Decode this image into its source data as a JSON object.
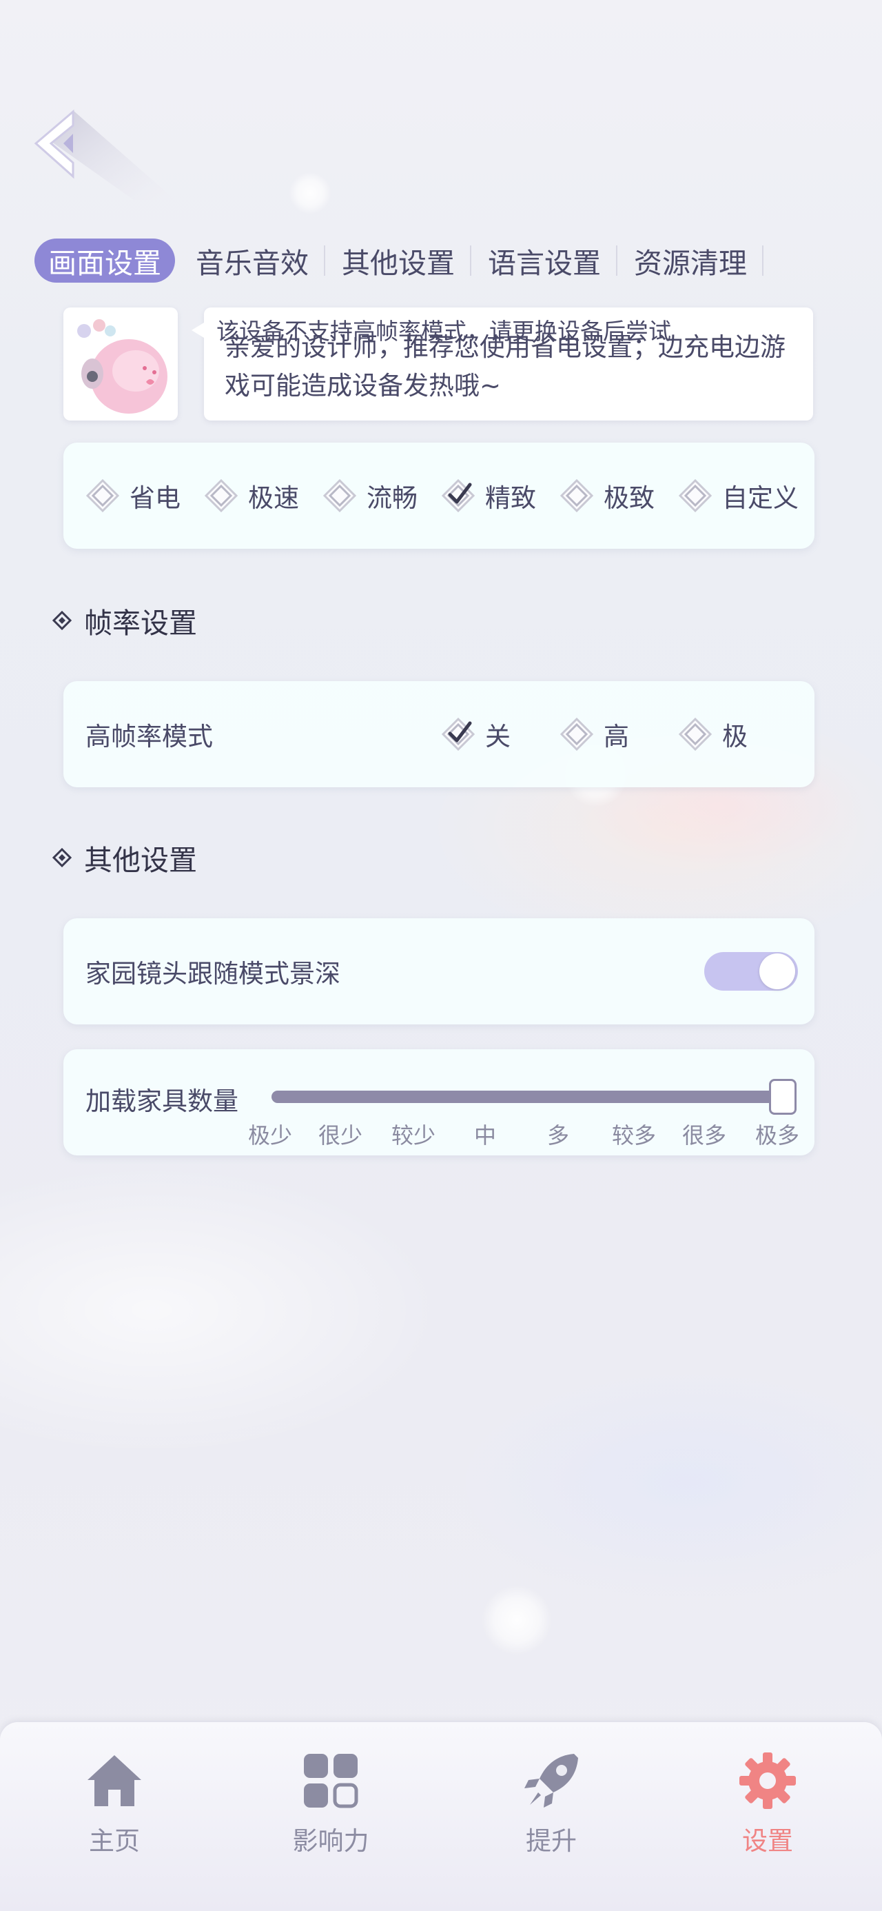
{
  "tabs": [
    {
      "label": "画面设置",
      "active": true
    },
    {
      "label": "音乐音效",
      "active": false
    },
    {
      "label": "其他设置",
      "active": false
    },
    {
      "label": "语言设置",
      "active": false
    },
    {
      "label": "资源清理",
      "active": false
    }
  ],
  "tip": {
    "overlay": "该设备不支持高帧率模式，请更换设备后尝试",
    "message": "亲爱的设计师，推荐您使用省电设置；边充电边游戏可能造成设备发热哦~"
  },
  "quality": {
    "options": [
      {
        "label": "省电",
        "checked": false
      },
      {
        "label": "极速",
        "checked": false
      },
      {
        "label": "流畅",
        "checked": false
      },
      {
        "label": "精致",
        "checked": true
      },
      {
        "label": "极致",
        "checked": false
      },
      {
        "label": "自定义",
        "checked": false
      }
    ]
  },
  "fps_section": {
    "title": "帧率设置",
    "row_label": "高帧率模式",
    "options": [
      {
        "label": "关",
        "checked": true
      },
      {
        "label": "高",
        "checked": false
      },
      {
        "label": "极",
        "checked": false
      }
    ]
  },
  "other_section": {
    "title": "其他设置",
    "depth_label": "家园镜头跟随模式景深",
    "depth_on": true,
    "furniture_label": "加载家具数量",
    "furniture_ticks": [
      "极少",
      "很少",
      "较少",
      "中",
      "多",
      "较多",
      "很多",
      "极多"
    ],
    "furniture_level": 1.0
  },
  "nav": [
    {
      "label": "主页",
      "icon": "home-icon",
      "active": false
    },
    {
      "label": "影响力",
      "icon": "grid-icon",
      "active": false
    },
    {
      "label": "提升",
      "icon": "rocket-icon",
      "active": false
    },
    {
      "label": "设置",
      "icon": "gear-icon",
      "active": true
    }
  ],
  "colors": {
    "accent": "#8e88d6",
    "active_nav": "#f08484",
    "text": "#4a4a68",
    "card": "#f5fefe"
  }
}
